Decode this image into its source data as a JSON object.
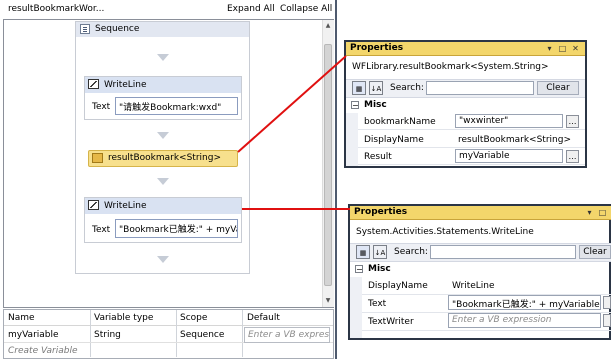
{
  "designer": {
    "title": "resultBookmarkWor...",
    "expand_all": "Expand All",
    "collapse_all": "Collapse All",
    "sequence_label": "Sequence",
    "writeline1": {
      "title": "WriteLine",
      "field_label": "Text",
      "field_value": "\"请触发Bookmark:wxd\""
    },
    "result_bookmark": "resultBookmark<String>",
    "writeline2": {
      "title": "WriteLine",
      "field_label": "Text",
      "field_value": "\"Bookmark已触发:\" + myVa"
    }
  },
  "variables": {
    "headers": [
      "Name",
      "Variable type",
      "Scope",
      "Default"
    ],
    "rows": [
      {
        "name": "myVariable",
        "type": "String",
        "scope": "Sequence",
        "default_placeholder": "Enter a VB express"
      }
    ],
    "create_label": "Create Variable"
  },
  "properties_top": {
    "title": "Properties",
    "type_name": "WFLibrary.resultBookmark<System.String>",
    "search_label": "Search:",
    "clear_label": "Clear",
    "category": "Misc",
    "rows": [
      {
        "name": "bookmarkName",
        "value": "\"wxwinter\""
      },
      {
        "name": "DisplayName",
        "value": "resultBookmark<String>"
      },
      {
        "name": "Result",
        "value": "myVariable"
      }
    ]
  },
  "properties_bottom": {
    "title": "Properties",
    "type_name": "System.Activities.Statements.WriteLine",
    "search_label": "Search:",
    "clear_label": "Clear",
    "category": "Misc",
    "rows": [
      {
        "name": "DisplayName",
        "value": "WriteLine"
      },
      {
        "name": "Text",
        "value": "\"Bookmark已触发:\" + myVariable"
      },
      {
        "name": "TextWriter",
        "value": "Enter a VB expression"
      }
    ]
  },
  "colors": {
    "connector": "#e01010",
    "panel_header": "#f3d66b",
    "activity_header": "#d9e2f2"
  }
}
